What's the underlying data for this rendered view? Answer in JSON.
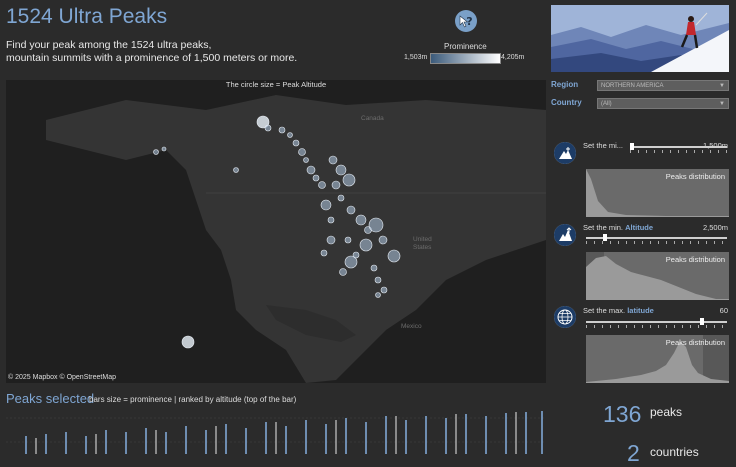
{
  "header": {
    "title": "1524 Ultra Peaks",
    "subtitle_line1": "Find your peak among the 1524 ultra peaks,",
    "subtitle_line2": "mountain summits with a prominence of 1,500 meters or more."
  },
  "legend": {
    "title": "Prominence",
    "min": "1,503m",
    "max": "4,205m"
  },
  "map": {
    "note": "The circle size = Peak Altitude",
    "attribution": "© 2025 Mapbox  © OpenStreetMap",
    "labels": {
      "canada": "Canada",
      "united_states_1": "United",
      "united_states_2": "States",
      "mexico": "Mexico"
    }
  },
  "filters": {
    "region_label": "Region",
    "region_value": "NORTHERN AMERICA",
    "country_label": "Country",
    "country_value": "(All)"
  },
  "sliders": [
    {
      "label_plain": "Set the mi...",
      "label_bold": "",
      "value": "1,500m",
      "level": 0.0
    },
    {
      "label_plain": "Set the min. ",
      "label_bold": "Altitude",
      "value": "2,500m",
      "level": 0.05
    },
    {
      "label_plain": "Set the max. ",
      "label_bold": "latitude",
      "value": "60",
      "level": 0.95
    }
  ],
  "distribution_label": "Peaks distribution",
  "peaks_selected": {
    "title": "Peaks selected",
    "subtitle": "bars size = prominence | ranked by altitude (top of the bar)"
  },
  "kpis": {
    "peaks_count": "136",
    "peaks_label": "peaks",
    "countries_count": "2",
    "countries_label": "countries"
  },
  "colors": {
    "accent": "#7fa6d3",
    "background": "#2b2b2b",
    "map": "#1f1f1f"
  },
  "icons": [
    "help-icon",
    "prominence-icon",
    "altitude-icon",
    "latitude-globe-icon"
  ]
}
